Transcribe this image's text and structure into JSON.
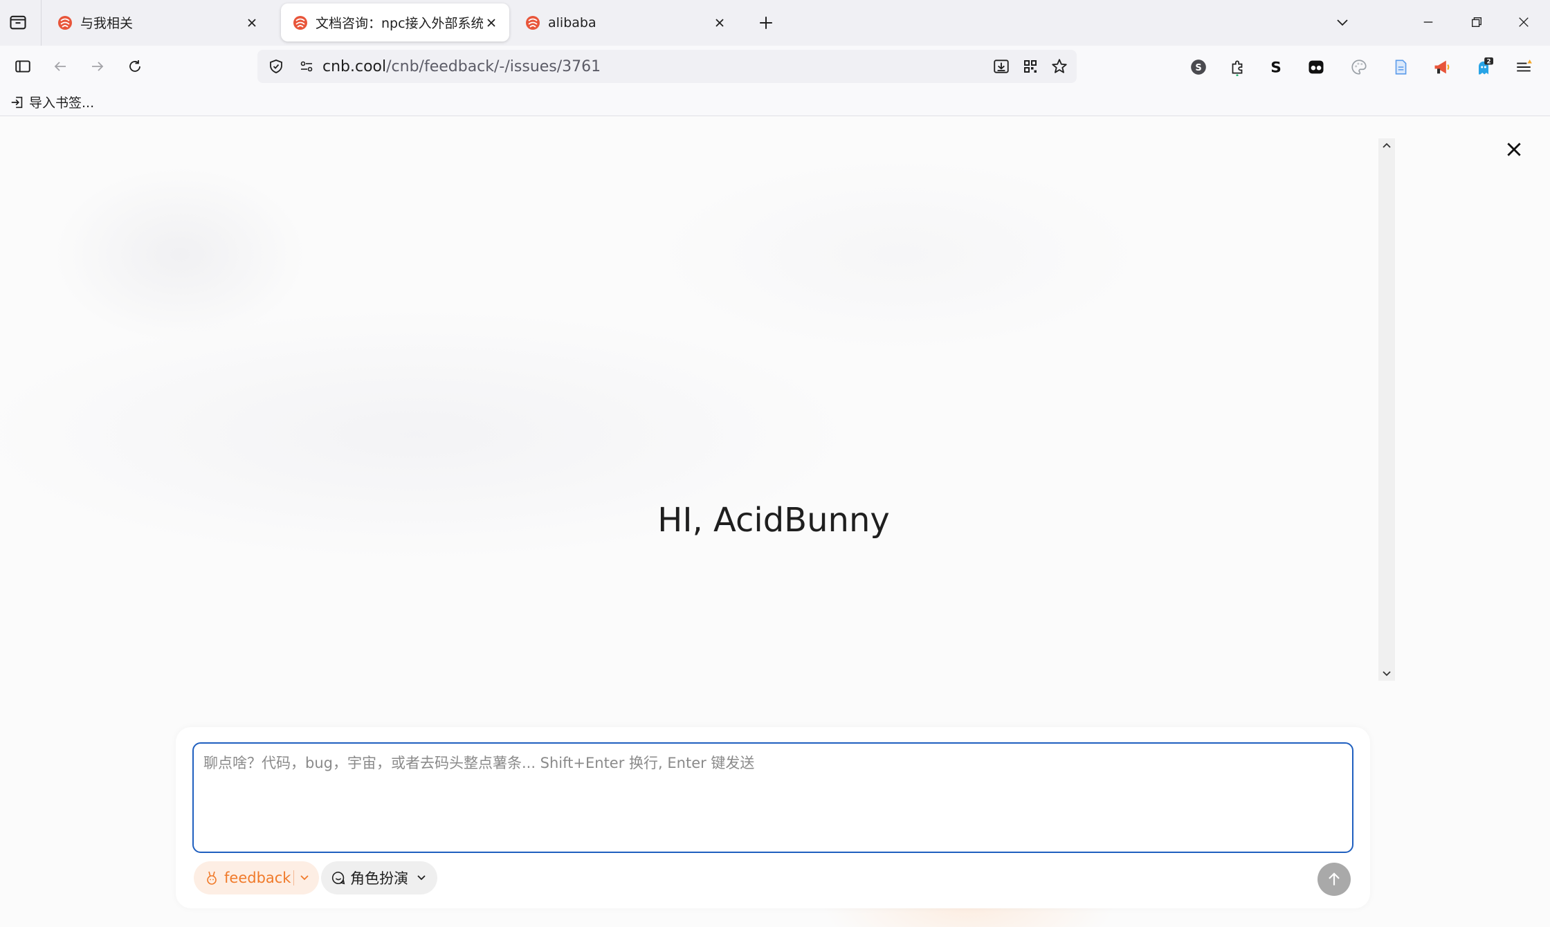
{
  "browser": {
    "tabs": [
      {
        "title": "与我相关",
        "active": false
      },
      {
        "title": "文档咨询：npc接入外部系统 · I",
        "active": true
      },
      {
        "title": "alibaba",
        "active": false
      }
    ],
    "url": {
      "host": "cnb.cool",
      "path": "/cnb/feedback/-/issues/3761"
    },
    "bookmarks": {
      "import_label": "导入书签..."
    },
    "extension_badge": "2",
    "extension_s_label": "S"
  },
  "page": {
    "greeting": "HI, AcidBunny",
    "composer": {
      "placeholder": "聊点啥？代码，bug，宇宙，或者去码头整点薯条... Shift+Enter 换行, Enter 键发送",
      "value": "",
      "repo_chip_label": "feedback",
      "role_chip_label": "角色扮演"
    }
  },
  "colors": {
    "accent_orange": "#f07a2a",
    "focus_blue": "#1f5fbf",
    "favicon_red": "#e8553a"
  },
  "icons": {
    "tab_favicon": "cnb-logo-icon",
    "send": "arrow-up-icon",
    "close": "close-icon"
  }
}
